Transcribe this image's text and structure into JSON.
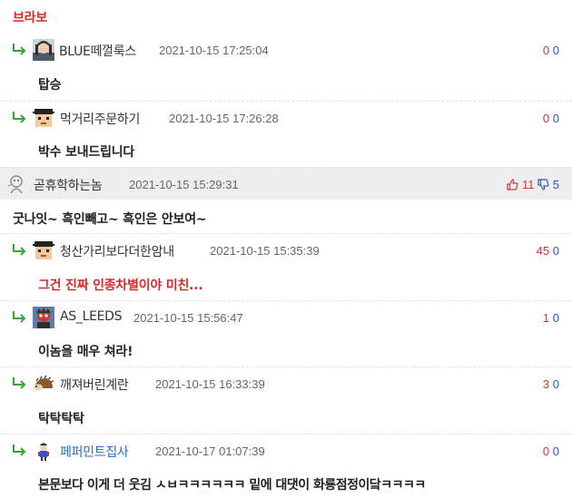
{
  "colors": {
    "upvote": "#e32d2d",
    "downvote": "#2c56c9",
    "reply_arrow": "#3aa335",
    "highlight_row": "#eeeeee"
  },
  "top_text": "브라보",
  "comments": [
    {
      "nickname": "BLUE떼껄룩스",
      "datetime": "2021-10-15 17:25:04",
      "up": "0",
      "down": "0",
      "body": "탑승",
      "avatar_icon": "photo-avatar-icon"
    },
    {
      "nickname": "먹거리주문하기",
      "datetime": "2021-10-15 17:26:28",
      "up": "0",
      "down": "0",
      "body": "박수 보내드립니다",
      "avatar_icon": "pixel-face-avatar-icon"
    },
    {
      "nickname": "곧휴학하는놈",
      "datetime": "2021-10-15 15:29:31",
      "up": "11",
      "down": "5",
      "body": "굿나잇~ 흑인빼고~ 흑인은 안보여~",
      "avatar_icon": "sketch-avatar-icon"
    },
    {
      "nickname": "청산가리보다더한암내",
      "datetime": "2021-10-15 15:35:39",
      "up": "45",
      "down": "0",
      "body": "그건 진짜 인종차별이야 미친...",
      "avatar_icon": "pixel-face-avatar-icon"
    },
    {
      "nickname": "AS_LEEDS",
      "datetime": "2021-10-15 15:56:47",
      "up": "1",
      "down": "0",
      "body": "이놈을 매우 쳐라!",
      "avatar_icon": "character-avatar-icon"
    },
    {
      "nickname": "깨져버린계란",
      "datetime": "2021-10-15 16:33:39",
      "up": "3",
      "down": "0",
      "body": "탁탁탁탁",
      "avatar_icon": "hedgehog-avatar-icon"
    },
    {
      "nickname": "페퍼민트집사",
      "datetime": "2021-10-17 01:07:39",
      "up": "0",
      "down": "0",
      "body": "본문보다 이게 더 웃김 ㅅㅂㅋㅋㅋㅋㅋㅋ 밑에 대댓이 화룡점정이닼ㅋㅋㅋㅋ",
      "avatar_icon": "small-character-avatar-icon"
    }
  ]
}
